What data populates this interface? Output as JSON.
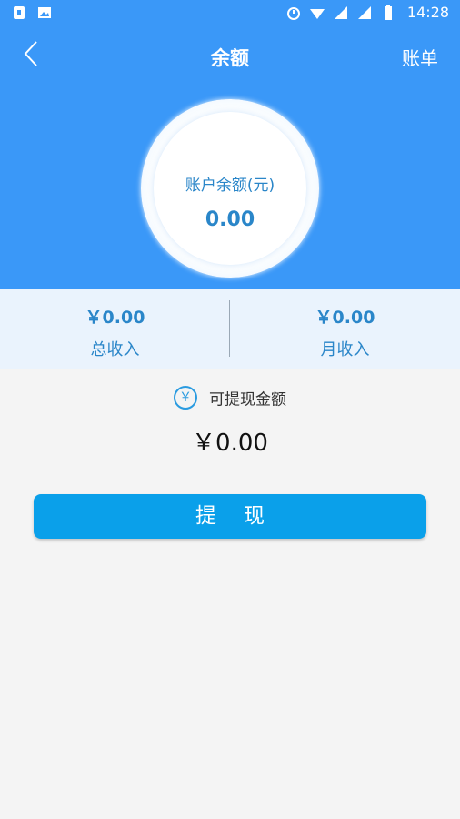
{
  "statusbar": {
    "time": "14:28"
  },
  "navbar": {
    "title": "余额",
    "right_label": "账单"
  },
  "balance": {
    "label": "账户余额(元)",
    "value": "0.00"
  },
  "stats": {
    "total": {
      "value": "￥0.00",
      "label": "总收入"
    },
    "monthly": {
      "value": "￥0.00",
      "label": "月收入"
    }
  },
  "withdrawable": {
    "icon_char": "￥",
    "label": "可提现金额",
    "value": "￥0.00"
  },
  "withdraw_button": {
    "label": "提现"
  },
  "colors": {
    "primary_blue": "#3a98f8",
    "accent_text": "#2a86c9",
    "button": "#0aa0ea"
  }
}
